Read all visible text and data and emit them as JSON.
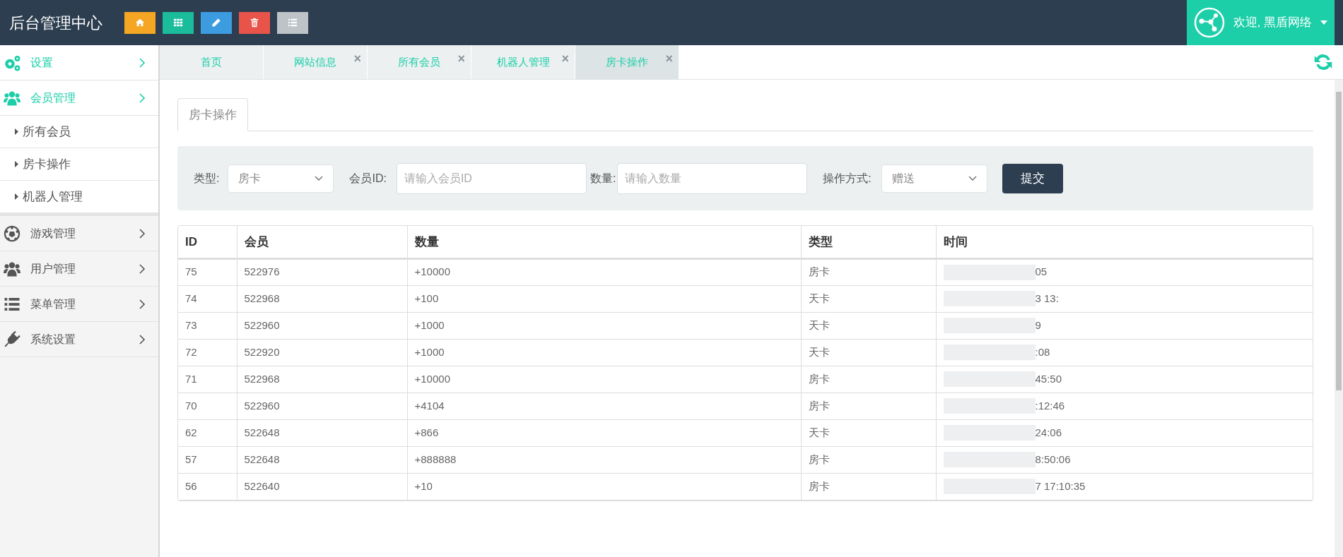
{
  "header": {
    "title": "后台管理中心",
    "buttons": [
      {
        "kind": "home",
        "color": "#f5a623"
      },
      {
        "kind": "grid",
        "color": "#1abc9c"
      },
      {
        "kind": "edit",
        "color": "#3d9be0"
      },
      {
        "kind": "trash",
        "color": "#e8544a"
      },
      {
        "kind": "list",
        "color": "#bdc3c7"
      }
    ],
    "user": "欢迎, 黑盾网络"
  },
  "sidebar": {
    "items": [
      {
        "label": "设置",
        "active": true
      },
      {
        "label": "会员管理",
        "active": true,
        "children": [
          {
            "label": "所有会员"
          },
          {
            "label": "房卡操作"
          },
          {
            "label": "机器人管理"
          }
        ]
      },
      {
        "label": "游戏管理",
        "active": false
      },
      {
        "label": "用户管理",
        "active": false
      },
      {
        "label": "菜单管理",
        "active": false
      },
      {
        "label": "系统设置",
        "active": false
      }
    ]
  },
  "tabs": [
    {
      "label": "首页",
      "closable": false,
      "selected": false
    },
    {
      "label": "网站信息",
      "closable": true,
      "selected": false
    },
    {
      "label": "所有会员",
      "closable": true,
      "selected": false
    },
    {
      "label": "机器人管理",
      "closable": true,
      "selected": false
    },
    {
      "label": "房卡操作",
      "closable": true,
      "selected": true
    }
  ],
  "close_glyph": "×",
  "page_tab": "房卡操作",
  "form": {
    "type_label": "类型:",
    "type_value": "房卡",
    "member_label": "会员ID:",
    "member_placeholder": "请输入会员ID",
    "amount_label": "数量:",
    "amount_placeholder": "请输入数量",
    "mode_label": "操作方式:",
    "mode_value": "赠送",
    "submit": "提交"
  },
  "table": {
    "columns": [
      "ID",
      "会员",
      "数量",
      "类型",
      "时间"
    ],
    "rows": [
      [
        "75",
        "522976",
        "+10000",
        "房卡",
        "05"
      ],
      [
        "74",
        "522968",
        "+100",
        "天卡",
        "3 13:"
      ],
      [
        "73",
        "522960",
        "+1000",
        "天卡",
        "9"
      ],
      [
        "72",
        "522920",
        "+1000",
        "天卡",
        ":08"
      ],
      [
        "71",
        "522968",
        "+10000",
        "房卡",
        "45:50"
      ],
      [
        "70",
        "522960",
        "+4104",
        "房卡",
        ":12:46"
      ],
      [
        "62",
        "522648",
        "+866",
        "天卡",
        "24:06"
      ],
      [
        "57",
        "522648",
        "+888888",
        "房卡",
        "8:50:06"
      ],
      [
        "56",
        "522640",
        "+10",
        "房卡",
        "7 17:10:35"
      ]
    ]
  }
}
